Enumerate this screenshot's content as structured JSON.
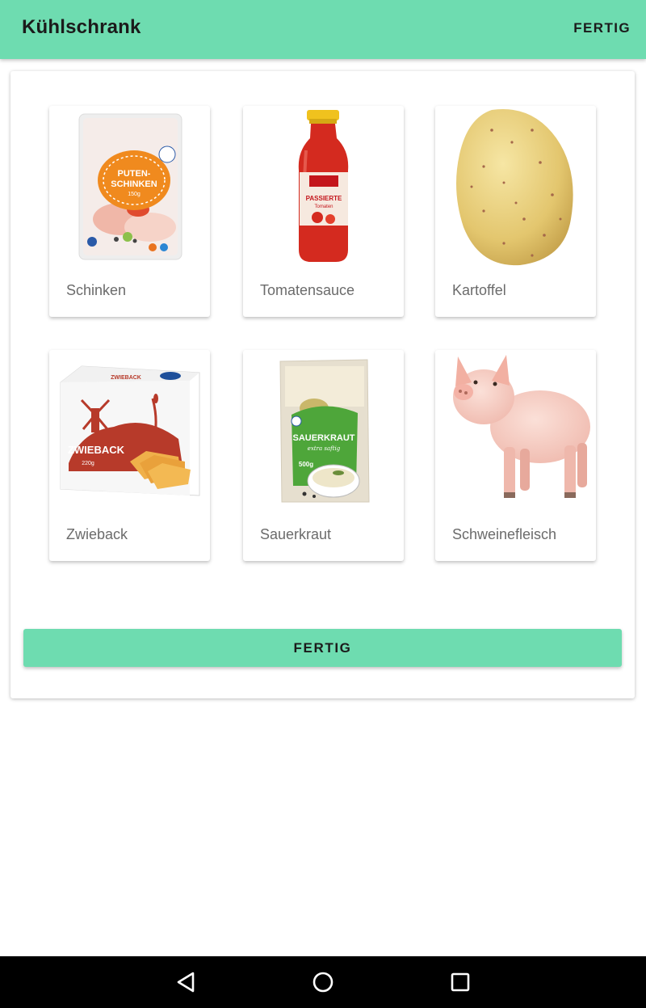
{
  "appbar": {
    "title": "Kühlschrank",
    "action_label": "FERTIG"
  },
  "items": [
    {
      "label": "Schinken",
      "icon": "ham-package-image"
    },
    {
      "label": "Tomatensauce",
      "icon": "tomato-sauce-bottle-image"
    },
    {
      "label": "Kartoffel",
      "icon": "potato-image"
    },
    {
      "label": "Zwieback",
      "icon": "zwieback-box-image"
    },
    {
      "label": "Sauerkraut",
      "icon": "sauerkraut-bag-image"
    },
    {
      "label": "Schweinefleisch",
      "icon": "pig-image"
    }
  ],
  "product_texts": {
    "ham_pack": "PUTEN-\nSCHINKEN",
    "ham_weight": "150g",
    "sauce_label": "PASSIERTE",
    "sauce_sub": "Tomaten",
    "zwieback_name": "ZWIEBACK",
    "zwieback_weight": "220g",
    "sauerkraut_name": "SAUERKRAUT",
    "sauerkraut_sub": "extra saftig",
    "sauerkraut_weight": "500g"
  },
  "done_button_label": "FERTIG",
  "colors": {
    "accent": "#6edcb0",
    "navbar": "#000000"
  },
  "navigation": [
    "back-icon",
    "home-icon",
    "recents-icon"
  ]
}
